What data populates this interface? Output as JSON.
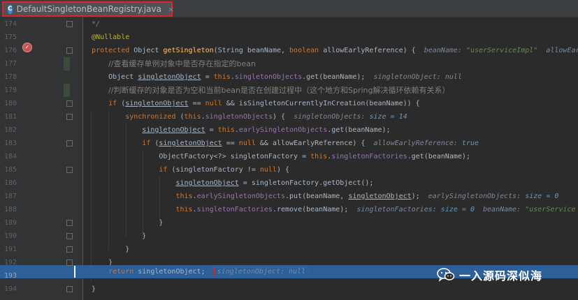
{
  "tab": {
    "icon": "C",
    "filename": "DefaultSingletonBeanRegistry.java",
    "close": "×"
  },
  "line_numbers": [
    "174",
    "175",
    "176",
    "177",
    "178",
    "179",
    "180",
    "181",
    "182",
    "183",
    "184",
    "185",
    "186",
    "187",
    "188",
    "189",
    "190",
    "191",
    "192",
    "193",
    "194"
  ],
  "code": {
    "l175": "*/",
    "l176_ann": "@Nullable",
    "l177_kw": "protected",
    "l177_a": " Object ",
    "l177_m": "getSingleton",
    "l177_b": "(String beanName, ",
    "l177_kw2": "boolean",
    "l177_c": " allowEarlyReference) {",
    "l177_d1": "beanName: ",
    "l177_d2": "\"userServiceImpl\"",
    "l177_d3": "allowEar",
    "l178": "//查看缓存单例对象中是否存在指定的bean",
    "l179_a": "Object ",
    "l179_v": "singletonObject",
    "l179_b": " = ",
    "l179_kw": "this",
    "l179_c": ".",
    "l179_f": "singletonObjects",
    "l179_d": ".get(beanName);",
    "l179_dbg": "singletonObject: null",
    "l180": "//判断缓存的对象是否为空和当前bean是否在创建过程中（这个地方和Spring解决循环依赖有关系）",
    "l181_kw": "if",
    "l181_a": " (",
    "l181_v": "singletonObject",
    "l181_b": " == ",
    "l181_kw2": "null",
    "l181_c": " && isSingletonCurrentlyInCreation(beanName)) {",
    "l182_kw": "synchronized",
    "l182_a": " (",
    "l182_kw2": "this",
    "l182_b": ".",
    "l182_f": "singletonObjects",
    "l182_c": ") {",
    "l182_d1": "singletonObjects: ",
    "l182_d2": "size = 14",
    "l183_v": "singletonObject",
    "l183_a": " = ",
    "l183_kw": "this",
    "l183_b": ".",
    "l183_f": "earlySingletonObjects",
    "l183_c": ".get(beanName);",
    "l184_kw": "if",
    "l184_a": " (",
    "l184_v": "singletonObject",
    "l184_b": " == ",
    "l184_kw2": "null",
    "l184_c": " && allowEarlyReference) {",
    "l184_d1": "allowEarlyReference: ",
    "l184_d2": "true",
    "l185_a": "ObjectFactory<?> singletonFactory = ",
    "l185_kw": "this",
    "l185_b": ".",
    "l185_f": "singletonFactories",
    "l185_c": ".get(beanName);",
    "l186_kw": "if",
    "l186_a": " (singletonFactory != ",
    "l186_kw2": "null",
    "l186_b": ") {",
    "l187_v": "singletonObject",
    "l187_a": " = singletonFactory.getObject();",
    "l188_kw": "this",
    "l188_a": ".",
    "l188_f": "earlySingletonObjects",
    "l188_b": ".put(beanName, ",
    "l188_v": "singletonObject",
    "l188_c": ");",
    "l188_d1": "earlySingletonObjects: ",
    "l188_d2": "size = 0",
    "l189_kw": "this",
    "l189_a": ".",
    "l189_f": "singletonFactories",
    "l189_b": ".remove(beanName);",
    "l189_d1": "singletonFactories: ",
    "l189_d2": "size = 0",
    "l189_d3": "beanName: ",
    "l189_d4": "\"userService",
    "brace_close": "}",
    "l193_kw": "return",
    "l193_a": " singletonObject;",
    "l193_dbg": "singletonObject: null"
  },
  "watermark": {
    "text": "一入源码深似海",
    "icon": "wechat-icon"
  },
  "colors": {
    "accent_red": "#e0232a",
    "highlight": "#2d6099",
    "keyword": "#cc7832",
    "string": "#6a8759",
    "number": "#6897bb"
  }
}
